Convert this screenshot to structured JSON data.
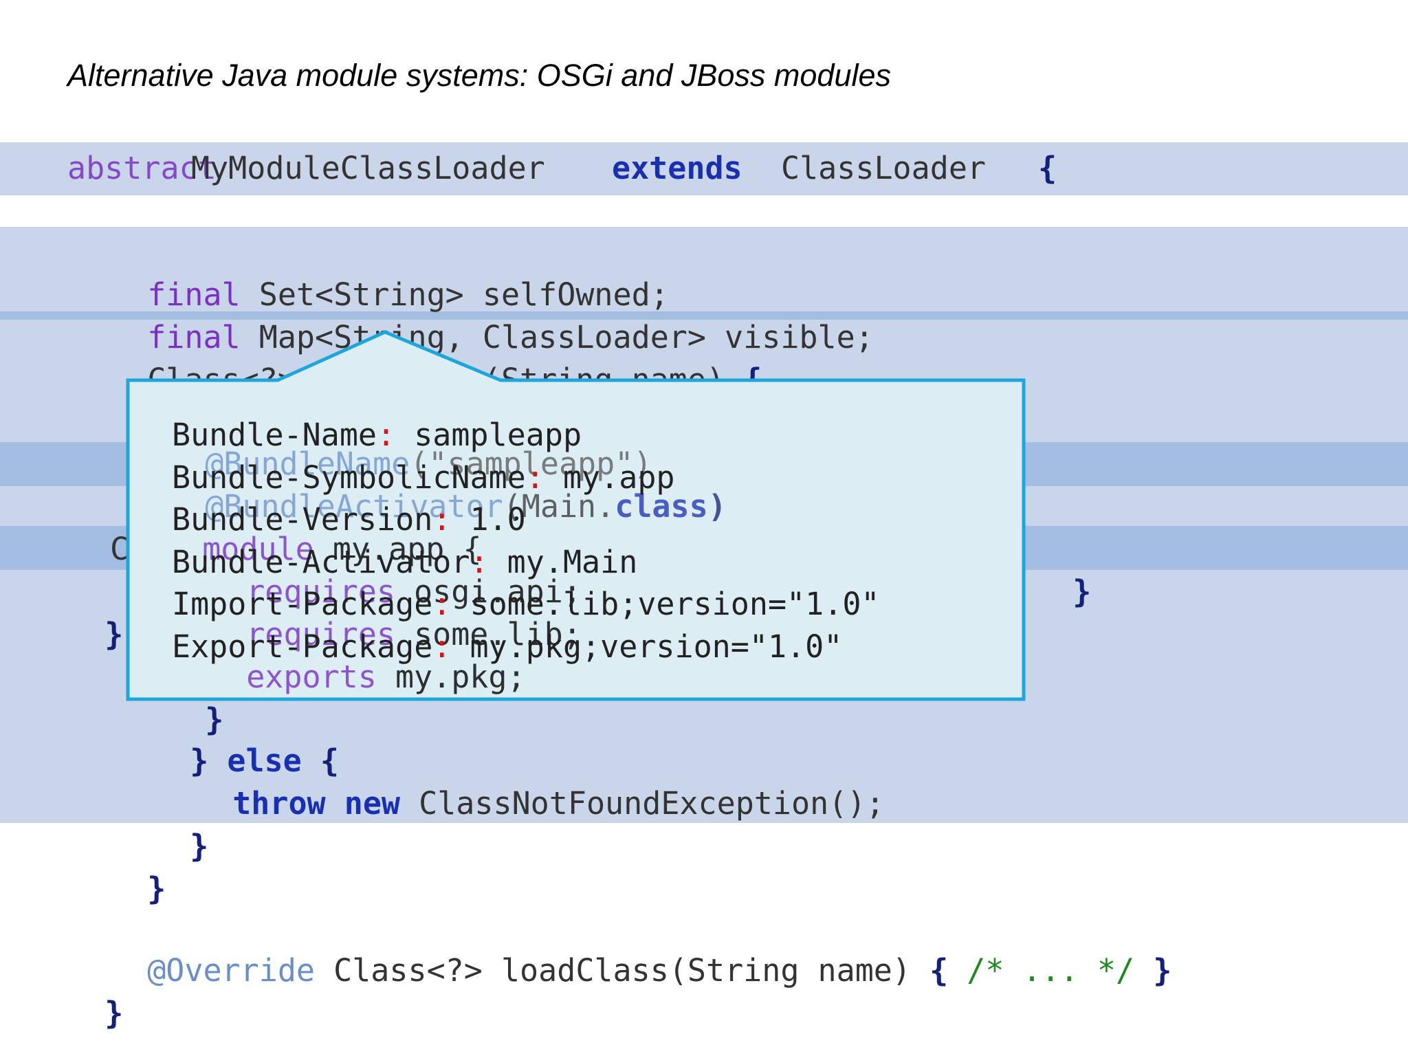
{
  "slide": {
    "title": "Alternative Java module systems: OSGi and JBoss modules"
  },
  "background_code": {
    "line1_overlap": "abstract",
    "line1_name": "MyModuleClassLoader",
    "line1_extends": "extends",
    "line1_parent": "ClassLoader",
    "line1_brace": "{",
    "final1": "final",
    "field1_type": "Set<String> selfOwned;",
    "final2": "final",
    "field2_type": "Map<String, ClassLoader> visible;",
    "method_sig": "Class<?> findClass(String name)",
    "brace_open": "{",
    "override_ghost": "@Override",
    "else_kw": "else",
    "throw_kw": "throw",
    "new_kw": "new",
    "exception": "ClassNotFoundException();",
    "override2": "@Override",
    "loadclass_sig": "Class<?> loadClass(String name)",
    "comment": "/* ... */",
    "close_brace": "}"
  },
  "popup": {
    "annotation1": "@BundleName",
    "annotation1_arg": "(\"sampleapp\")",
    "annotation2": "@BundleActivator",
    "annotation2_arg": "(Main.",
    "annotation2_kw": "class",
    "annotation2_close": ")",
    "module_kw": "module",
    "module_name": "my.app {",
    "requires1_kw": "requires",
    "requires1_val": "osgi.api;",
    "requires2_kw": "requires",
    "requires2_val": "some.lib;",
    "exports_kw": "exports",
    "exports_val": "my.pkg;",
    "module_close": "}",
    "manifest": [
      {
        "key": "Bundle-Name",
        "value": " sampleapp"
      },
      {
        "key": "Bundle-SymbolicName",
        "value": " my.app"
      },
      {
        "key": "Bundle-Version",
        "value": " 1.0"
      },
      {
        "key": "Bundle-Activator",
        "value": " my.Main"
      },
      {
        "key": "Import-Package",
        "value": " some.lib;version=\"1.0\""
      },
      {
        "key": "Export-Package",
        "value": " my.pkg;version=\"1.0\""
      }
    ],
    "colon": ":"
  },
  "colors": {
    "band_light": "#c9d6ea",
    "band_mid": "#b7c8e3",
    "band_dark": "#a3bde0",
    "popup_fill": "#dcedf4",
    "popup_border": "#1ea6dc"
  }
}
